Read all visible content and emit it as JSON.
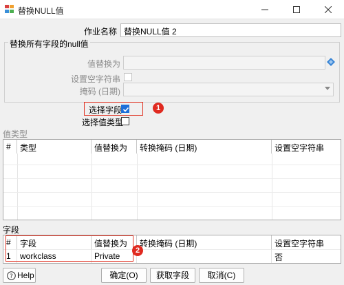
{
  "window": {
    "title": "替换NULL值",
    "minimize_icon": "minimize-icon",
    "maximize_icon": "maximize-icon",
    "close_icon": "close-icon"
  },
  "job_name": {
    "label": "作业名称",
    "value": "替换NULL值 2"
  },
  "all_fields_group": {
    "title": "替换所有字段的null值",
    "replace_with_label": "值替换为",
    "replace_with_value": "",
    "empty_string_label": "设置空字符串",
    "empty_string_checked": false,
    "mask_label": "掩码 (日期)",
    "mask_value": ""
  },
  "select_fields": {
    "label": "选择字段",
    "checked": true
  },
  "select_value_types": {
    "label": "选择值类型",
    "checked": false
  },
  "annotations": {
    "badge1": "1",
    "badge2": "2"
  },
  "value_types": {
    "section_label": "值类型",
    "columns": [
      "#",
      "类型",
      "值替换为",
      "转换掩码 (日期)",
      "设置空字符串"
    ],
    "rows": []
  },
  "fields": {
    "section_label": "字段",
    "columns": [
      "#",
      "字段",
      "值替换为",
      "转换掩码 (日期)",
      "设置空字符串"
    ],
    "rows": [
      [
        "1",
        "workclass",
        "Private",
        "",
        "否"
      ]
    ]
  },
  "buttons": {
    "help": "Help",
    "ok": "确定(O)",
    "get_fields": "获取字段",
    "cancel": "取消(C)"
  },
  "colors": {
    "accent": "#1e6fd9",
    "annotation_red": "#e02a20"
  }
}
